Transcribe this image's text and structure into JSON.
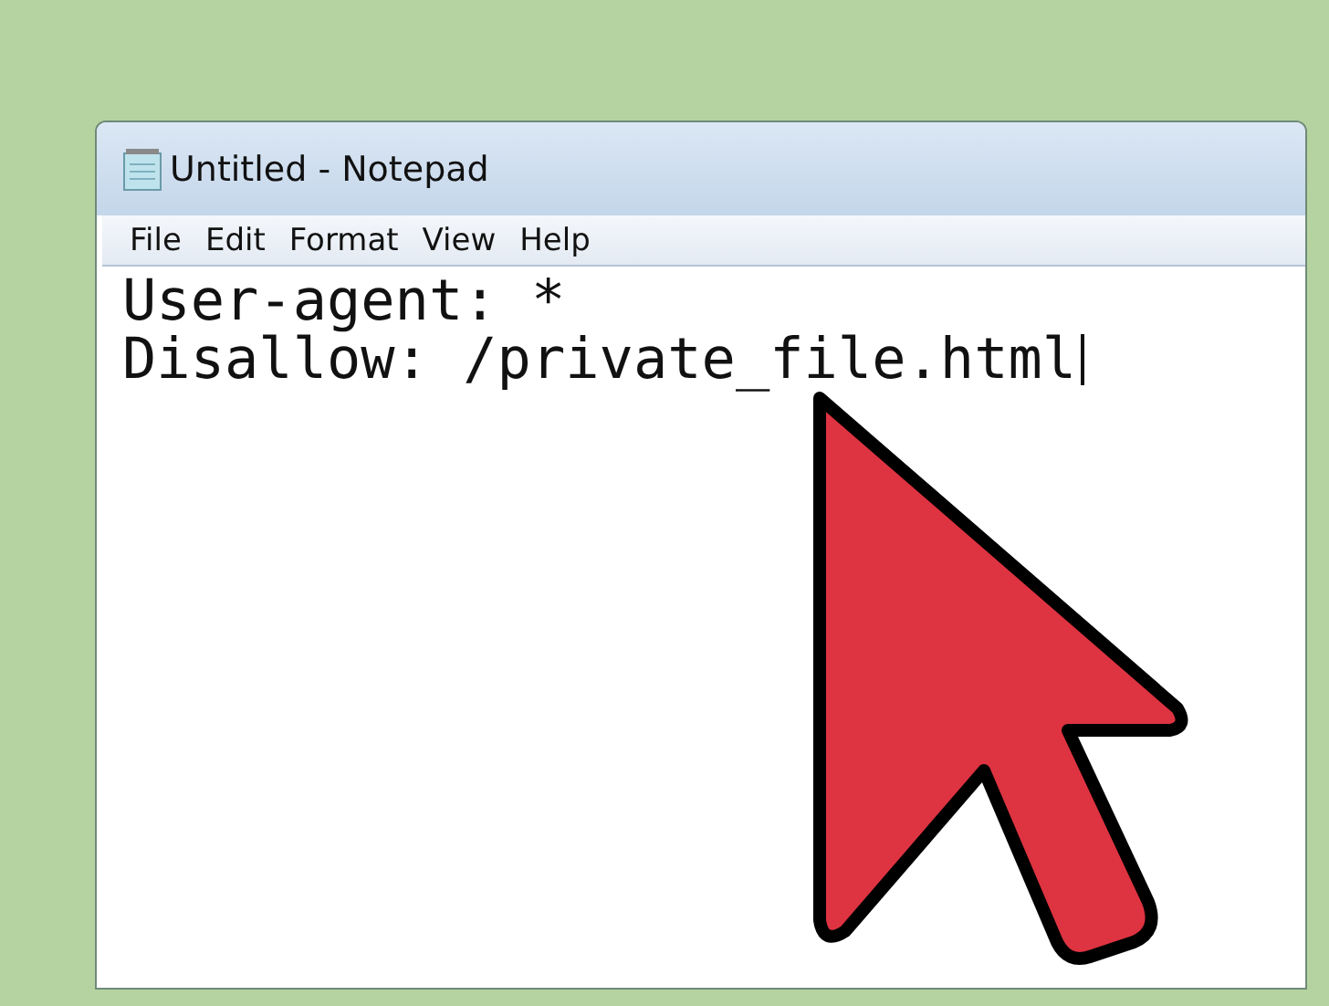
{
  "window": {
    "title": "Untitled - Notepad"
  },
  "menu": [
    "File",
    "Edit",
    "Format",
    "View",
    "Help"
  ],
  "editor": {
    "lines": [
      "User-agent: *",
      "Disallow: /private_file.html"
    ]
  }
}
